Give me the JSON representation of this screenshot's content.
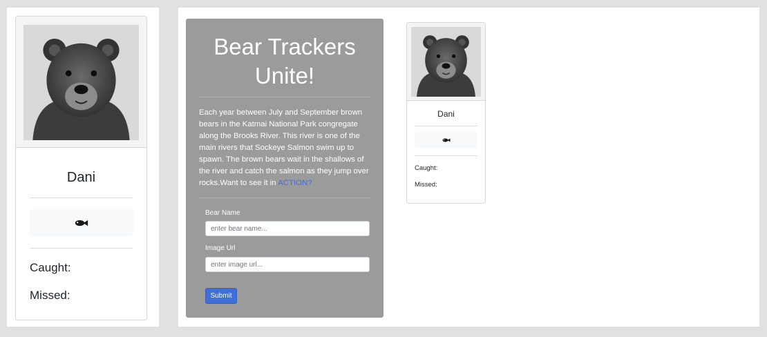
{
  "left_card": {
    "bear_name": "Dani",
    "caught_label": "Caught:",
    "missed_label": "Missed:",
    "fish_icon": "fish-icon"
  },
  "form": {
    "title": "Bear Trackers\nUnite!",
    "description": "Each year between July and September brown bears in the Katmai National Park congregate along the Brooks River. This river is one of the main rivers that Sockeye Salmon swim up to spawn. The brown bears wait in the shallows of the river and catch the salmon as they jump over rocks.Want to see it in",
    "action_link": "ACTION?",
    "bear_name_label": "Bear Name",
    "bear_name_placeholder": "enter bear name...",
    "image_url_label": "Image Url",
    "image_url_placeholder": "enter image url...",
    "submit_label": "Submit"
  },
  "bear_cards": [
    {
      "bear_name": "Dani",
      "caught_label": "Caught:",
      "missed_label": "Missed:",
      "fish_icon": "fish-icon"
    }
  ],
  "colors": {
    "page_bg": "#e1e1e1",
    "form_bg": "#9b9b9b",
    "link": "#3a6eea",
    "submit": "#3f6fd9"
  }
}
